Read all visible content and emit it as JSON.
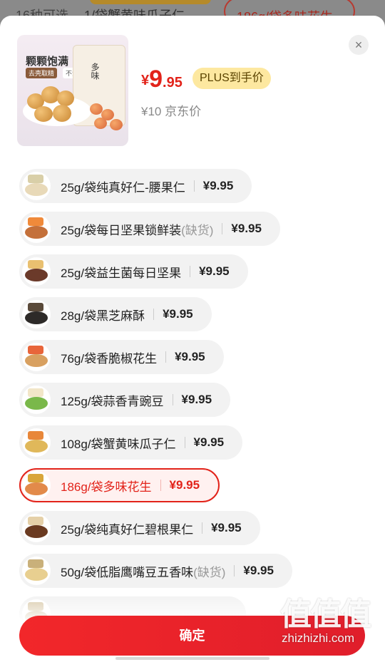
{
  "background": {
    "count_text": "16种可选",
    "variant_text": "1/袋蟹黄味瓜子仁",
    "selected_chip": "186g/袋多味花生"
  },
  "product": {
    "thumb_title": "颗颗饱满",
    "thumb_tag1": "去壳取精",
    "thumb_tag2": "不油腻",
    "bag_text": "多味",
    "price_currency": "¥",
    "price_int": "9",
    "price_dec": ".95",
    "plus_badge": "PLUS到手价",
    "jd_price": "¥10 京东价"
  },
  "close_label": "×",
  "variants": [
    {
      "name": "25g/袋纯真好仁-腰果仁",
      "oos": "",
      "price": "¥9.95",
      "icon_color": "#e8d9b8"
    },
    {
      "name": "25g/袋每日坚果锁鲜装",
      "oos": "(缺货)",
      "price": "¥9.95",
      "icon_color": "#c4703a"
    },
    {
      "name": "25g/袋益生菌每日坚果",
      "oos": "",
      "price": "¥9.95",
      "icon_color": "#6b3a2a"
    },
    {
      "name": "28g/袋黑芝麻酥",
      "oos": "",
      "price": "¥9.95",
      "icon_color": "#2d2a28"
    },
    {
      "name": "76g/袋香脆椒花生",
      "oos": "",
      "price": "¥9.95",
      "icon_color": "#d8a060"
    },
    {
      "name": "125g/袋蒜香青豌豆",
      "oos": "",
      "price": "¥9.95",
      "icon_color": "#7ab84a"
    },
    {
      "name": "108g/袋蟹黄味瓜子仁",
      "oos": "",
      "price": "¥9.95",
      "icon_color": "#e0b85a"
    },
    {
      "name": "186g/袋多味花生",
      "oos": "",
      "price": "¥9.95",
      "icon_color": "#e28a4a",
      "selected": true
    },
    {
      "name": "25g/袋纯真好仁碧根果仁",
      "oos": "",
      "price": "¥9.95",
      "icon_color": "#6a3a20"
    },
    {
      "name": "50g/袋低脂鹰嘴豆五香味",
      "oos": "(缺货)",
      "price": "¥9.95",
      "icon_color": "#e8cf90"
    },
    {
      "name": "",
      "oos": "",
      "price": "",
      "icon_color": "#d0c0a0"
    }
  ],
  "confirm_label": "确定",
  "watermark": {
    "logo": "值值值",
    "url": "zhizhizhi.com"
  }
}
